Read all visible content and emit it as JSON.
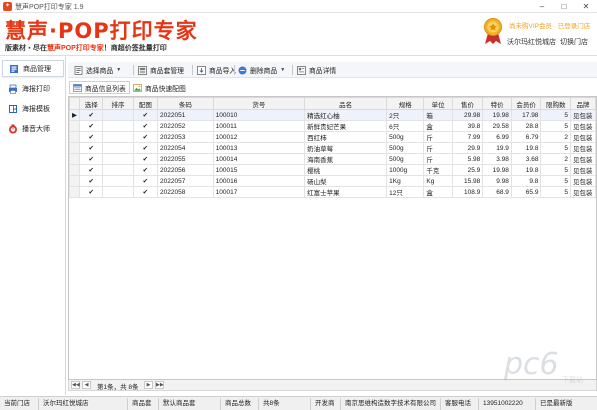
{
  "window": {
    "title": "慧声POP打印专家 1.9",
    "icon": "app-logo-icon"
  },
  "banner": {
    "logo_text": "慧声·POP打印专家",
    "slogan_prefix": "版素材・尽在",
    "slogan_highlight": "慧声POP打印专家",
    "slogan_suffix": "！商超价签批量打印",
    "vip_text": "尚未购VIP会员 · 已登录门店",
    "store_name": "沃尔玛红悦城店",
    "switch_store": "切换门店"
  },
  "sidebar": {
    "items": [
      {
        "label": "商品管理",
        "icon": "product-management-icon",
        "active": true
      },
      {
        "label": "海报打印",
        "icon": "print-icon",
        "active": false
      },
      {
        "label": "海报模板",
        "icon": "template-icon",
        "active": false
      },
      {
        "label": "播音大师",
        "icon": "broadcast-icon",
        "active": false
      }
    ]
  },
  "toolbar": {
    "select_products": "选择商品",
    "product_set_manage": "商品套管理",
    "product_import": "商品导入",
    "delete_products": "删除商品",
    "product_details": "商品详情"
  },
  "subtabs": [
    {
      "label": "商品信息列表",
      "active": true
    },
    {
      "label": "商品快速配图",
      "active": false
    }
  ],
  "grid": {
    "columns": [
      "选择",
      "排序",
      "配图",
      "条码",
      "货号",
      "品名",
      "规格",
      "单位",
      "售价",
      "特价",
      "会员价",
      "限购数",
      "品牌"
    ],
    "rows": [
      {
        "select": true,
        "sort": "",
        "image": true,
        "barcode": "2022051",
        "sku": "100010",
        "name": "精选红心柚",
        "spec": "2只",
        "unit": "箱",
        "price": "29.98",
        "special": "19.98",
        "member": "17.98",
        "limit": "5",
        "brand": "见包装"
      },
      {
        "select": true,
        "sort": "",
        "image": true,
        "barcode": "2022052",
        "sku": "100011",
        "name": "新鲜贵妃芒果",
        "spec": "6只",
        "unit": "盒",
        "price": "39.8",
        "special": "29.58",
        "member": "28.8",
        "limit": "5",
        "brand": "见包装"
      },
      {
        "select": true,
        "sort": "",
        "image": true,
        "barcode": "2022053",
        "sku": "100012",
        "name": "西红柿",
        "spec": "500g",
        "unit": "斤",
        "price": "7.99",
        "special": "6.99",
        "member": "6.79",
        "limit": "2",
        "brand": "见包装"
      },
      {
        "select": true,
        "sort": "",
        "image": true,
        "barcode": "2022054",
        "sku": "100013",
        "name": "奶油草莓",
        "spec": "500g",
        "unit": "斤",
        "price": "29.9",
        "special": "19.9",
        "member": "19.8",
        "limit": "5",
        "brand": "见包装"
      },
      {
        "select": true,
        "sort": "",
        "image": true,
        "barcode": "2022055",
        "sku": "100014",
        "name": "海南香蕉",
        "spec": "500g",
        "unit": "斤",
        "price": "5.98",
        "special": "3.98",
        "member": "3.68",
        "limit": "2",
        "brand": "见包装"
      },
      {
        "select": true,
        "sort": "",
        "image": true,
        "barcode": "2022056",
        "sku": "100015",
        "name": "樱桃",
        "spec": "1000g",
        "unit": "千克",
        "price": "25.9",
        "special": "19.98",
        "member": "19.8",
        "limit": "5",
        "brand": "见包装"
      },
      {
        "select": true,
        "sort": "",
        "image": true,
        "barcode": "2022057",
        "sku": "100016",
        "name": "砀山梨",
        "spec": "1Kg",
        "unit": "Kg",
        "price": "15.98",
        "special": "9.98",
        "member": "9.8",
        "limit": "5",
        "brand": "见包装"
      },
      {
        "select": true,
        "sort": "",
        "image": true,
        "barcode": "2022058",
        "sku": "100017",
        "name": "红富士苹果",
        "spec": "12只",
        "unit": "盒",
        "price": "108.9",
        "special": "68.9",
        "member": "65.9",
        "limit": "5",
        "brand": "见包装"
      }
    ]
  },
  "pager": {
    "text": "第1条，共 8条"
  },
  "status": {
    "current_store_label": "当前门店",
    "current_store": "沃尔玛红悦城店",
    "product_set_label": "商品套",
    "product_set": "默认商品套",
    "product_total_label": "商品总数",
    "product_total": "共8条",
    "developer_label": "开发商",
    "developer": "南京思维构造数字技术有限公司",
    "phone_label": "客服电话",
    "phone": "13951002220",
    "version": "已是最新版"
  },
  "colors": {
    "brand_red": "#e63515",
    "vip_gold": "#f0a020"
  }
}
